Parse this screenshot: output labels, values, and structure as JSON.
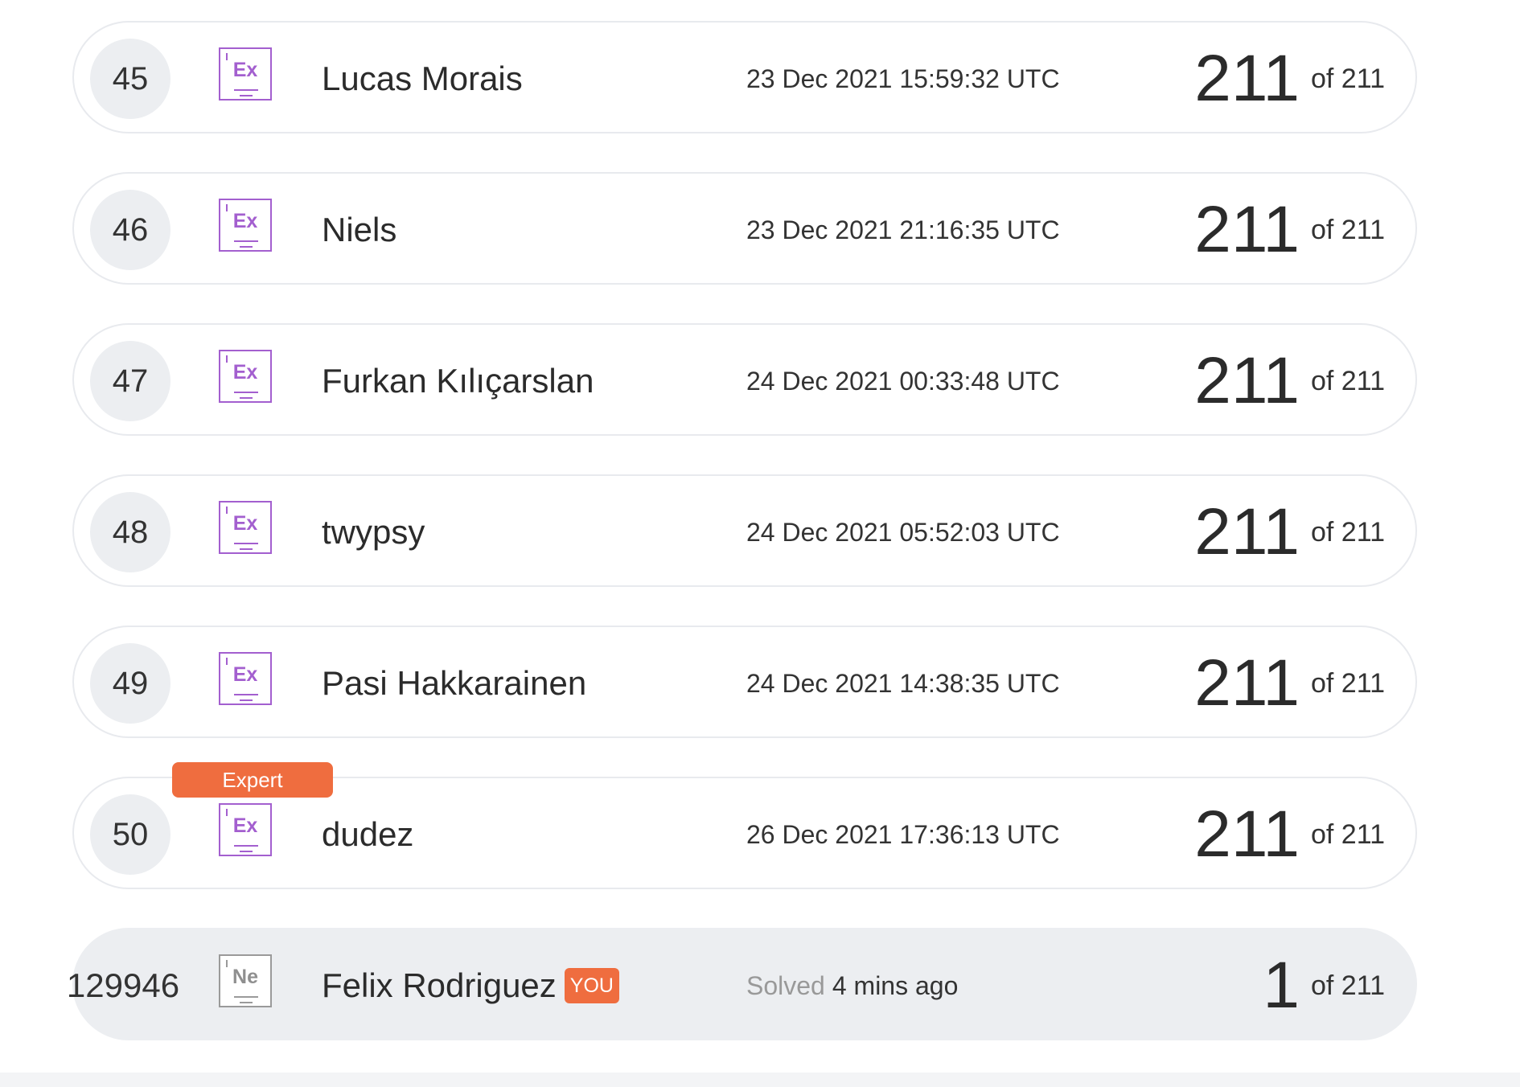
{
  "leaderboard": {
    "rows": [
      {
        "rank": "45",
        "level_abbr": "Ex",
        "level_tag": "",
        "name": "Lucas Morais",
        "timestamp": "23 Dec 2021 15:59:32 UTC",
        "score": "211",
        "score_total": "of 211"
      },
      {
        "rank": "46",
        "level_abbr": "Ex",
        "level_tag": "",
        "name": "Niels",
        "timestamp": "23 Dec 2021 21:16:35 UTC",
        "score": "211",
        "score_total": "of 211"
      },
      {
        "rank": "47",
        "level_abbr": "Ex",
        "level_tag": "",
        "name": "Furkan Kılıçarslan",
        "timestamp": "24 Dec 2021 00:33:48 UTC",
        "score": "211",
        "score_total": "of 211"
      },
      {
        "rank": "48",
        "level_abbr": "Ex",
        "level_tag": "",
        "name": "twypsy",
        "timestamp": "24 Dec 2021 05:52:03 UTC",
        "score": "211",
        "score_total": "of 211"
      },
      {
        "rank": "49",
        "level_abbr": "Ex",
        "level_tag": "",
        "name": "Pasi Hakkarainen",
        "timestamp": "24 Dec 2021 14:38:35 UTC",
        "score": "211",
        "score_total": "of 211"
      },
      {
        "rank": "50",
        "level_abbr": "Ex",
        "level_tag": "Expert",
        "name": "dudez",
        "timestamp": "26 Dec 2021 17:36:13 UTC",
        "score": "211",
        "score_total": "of 211"
      }
    ],
    "current_user": {
      "rank": "129946",
      "level_abbr": "Ne",
      "name": "Felix Rodriguez",
      "you_badge": "YOU",
      "solved_label": "Solved",
      "solved_time": "4 mins ago",
      "score": "1",
      "score_total": "of 211"
    }
  },
  "colors": {
    "expert_purple": "#a35fcf",
    "novice_gray": "#9a9a9a",
    "accent_orange": "#ef6d3f",
    "row_border": "#e8eaee",
    "current_row_background": "#eceef1"
  },
  "icons": {
    "expert_level": "expert-level-icon",
    "novice_level": "novice-level-icon"
  }
}
